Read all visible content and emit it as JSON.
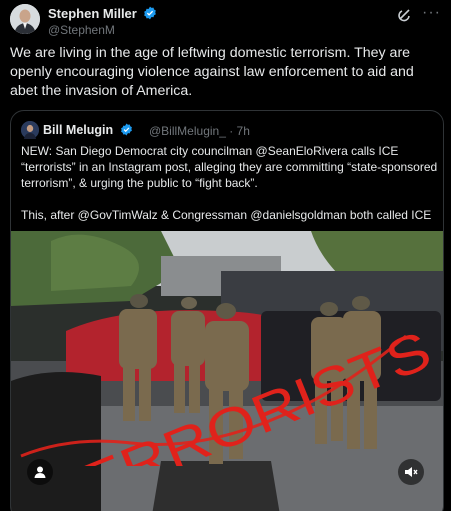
{
  "post": {
    "author_name": "Stephen Miller",
    "author_handle": "@StephenM",
    "text": "We are living in the age of leftwing domestic terrorism. They are openly encouraging violence against law enforcement to aid and abet the invasion of America."
  },
  "quoted": {
    "author_name": "Bill Melugin",
    "author_handle_time": "@BillMelugin_ · 7h",
    "text_line1": "NEW: San Diego Democrat city councilman @SeanEloRivera calls ICE “terrorists” in an Instagram post, alleging they are committing “state-sponsored terrorism”, & urging the public to “fight back”.",
    "text_line2": "This, after @GovTimWalz & Congressman @danielsgoldman both called ICE ...",
    "video_overlay_text": "TERRORISTS"
  },
  "icons": {
    "verified": "verified-badge-icon",
    "grok": "grok-icon",
    "more": "more-icon",
    "user": "user-icon",
    "mute": "mute-icon"
  },
  "colors": {
    "verified": "#1d9bf0",
    "overlay_text": "#e0221b"
  }
}
